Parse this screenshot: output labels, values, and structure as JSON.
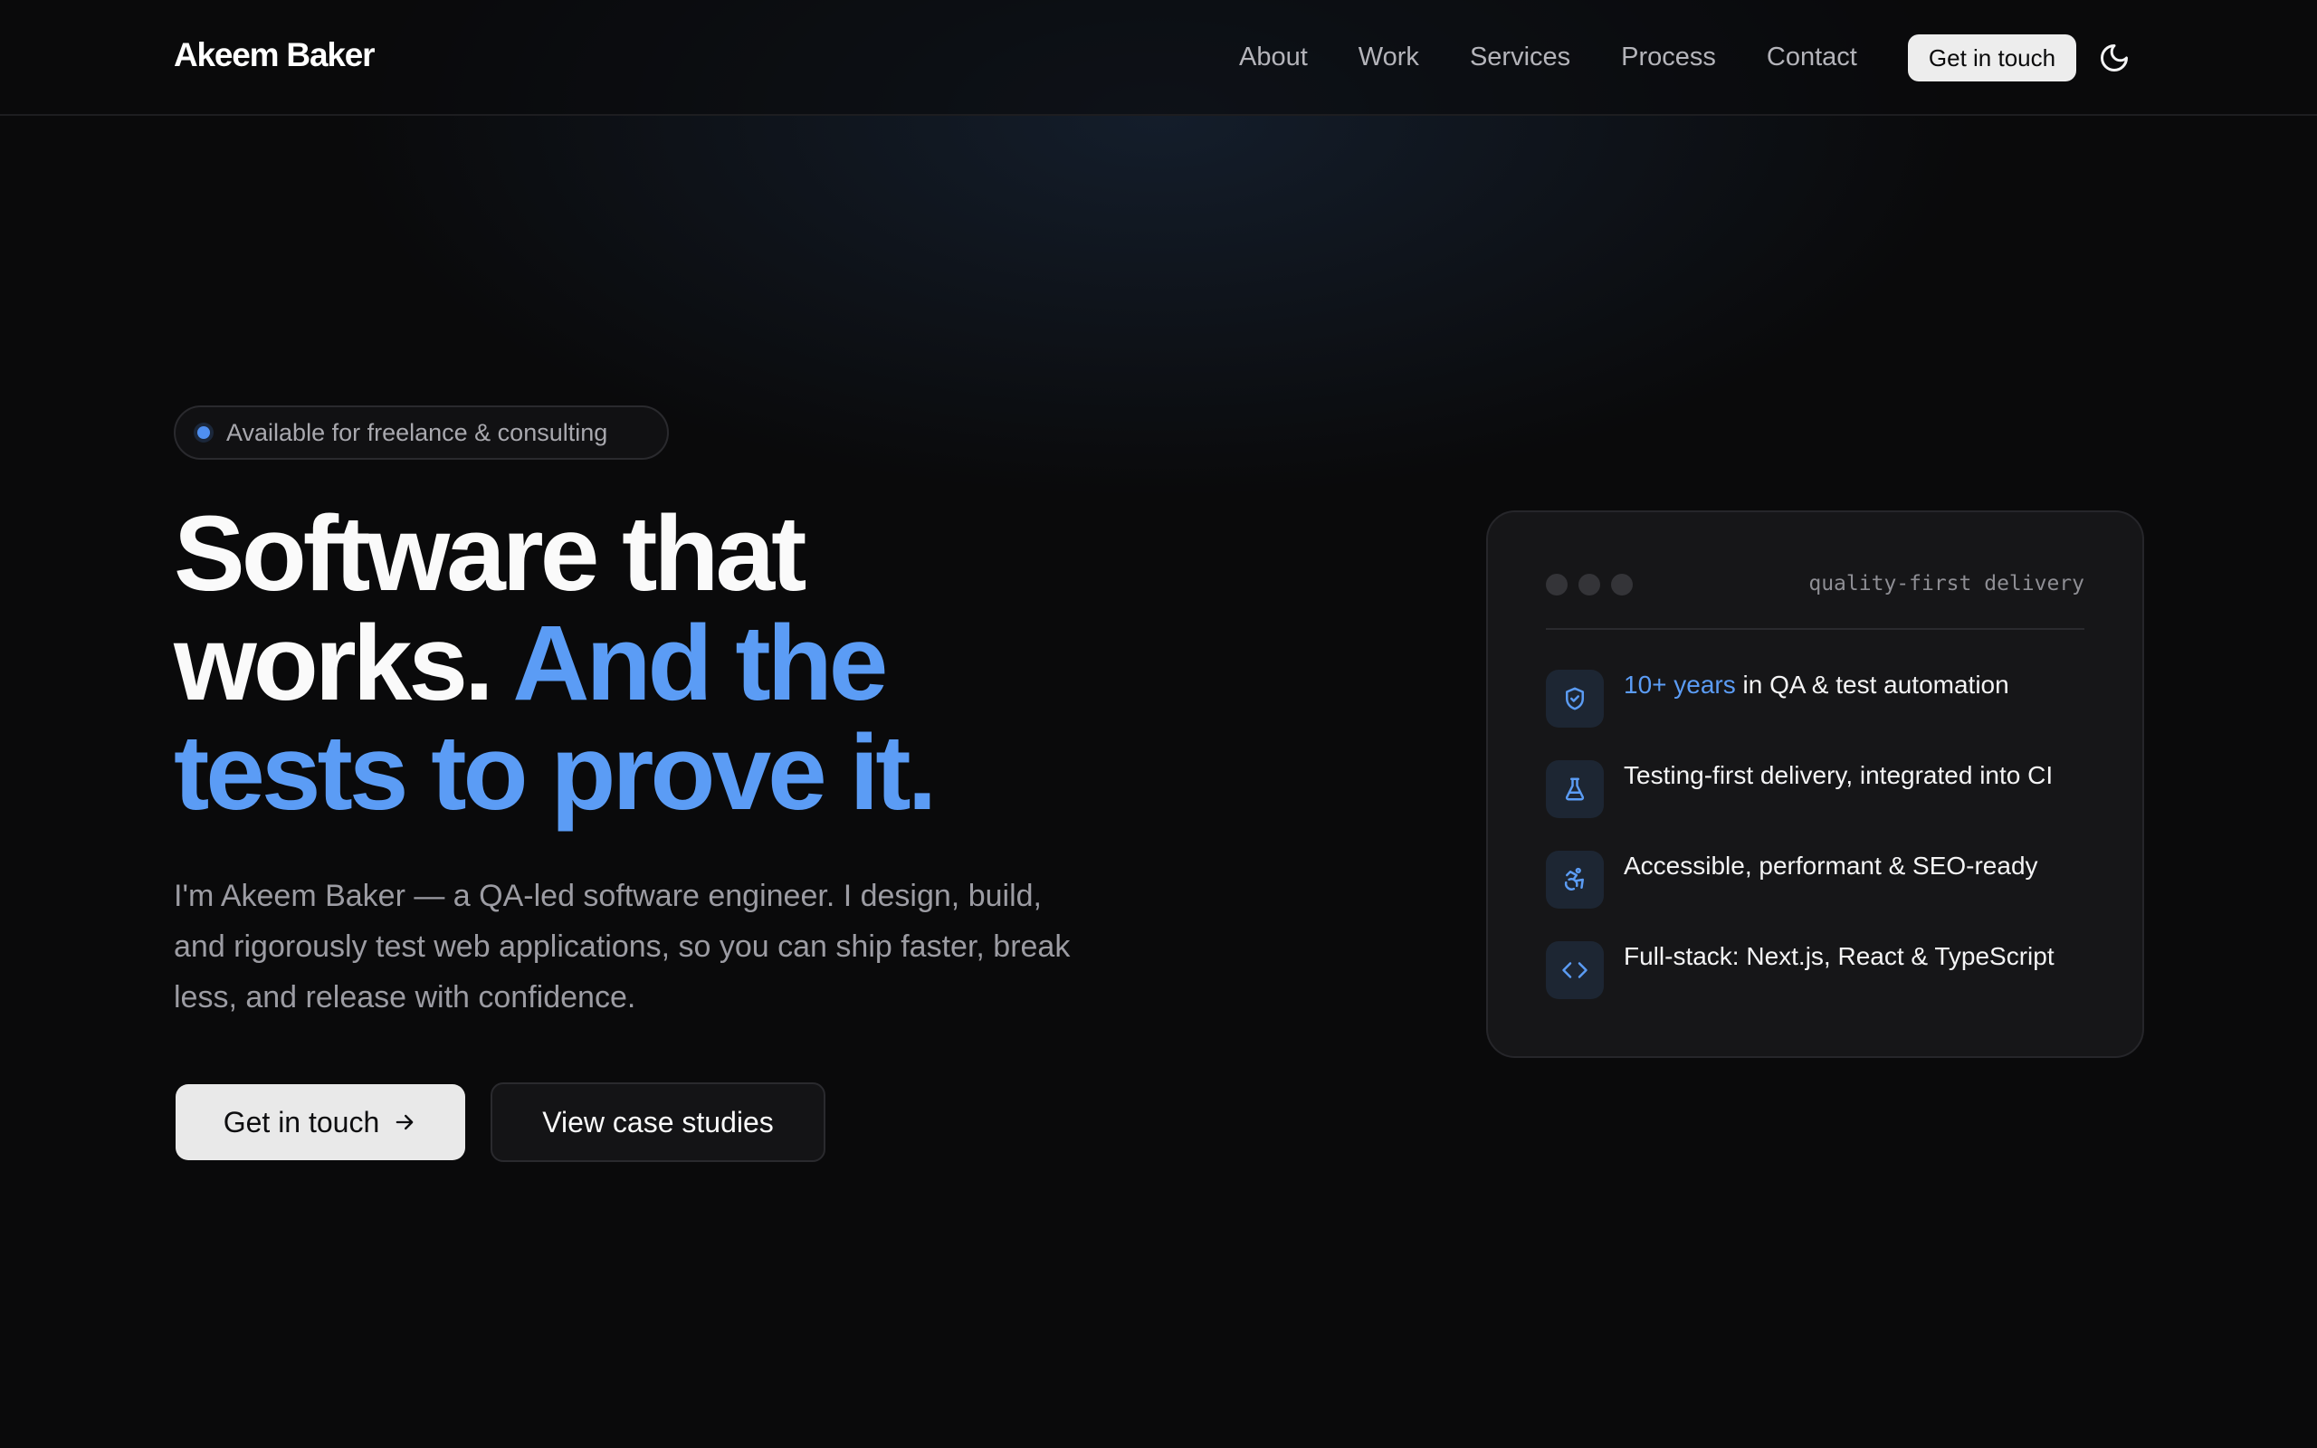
{
  "brand": "Akeem Baker",
  "nav": {
    "links": [
      "About",
      "Work",
      "Services",
      "Process",
      "Contact"
    ],
    "cta": "Get in touch",
    "theme_icon": "moon-icon"
  },
  "hero": {
    "badge": "Available for freelance & consulting",
    "headline_line1": "Software that",
    "headline_line2_plain": "works.",
    "headline_line2_accent": "And the",
    "headline_line3_accent": "tests to prove it.",
    "lead": "I'm Akeem Baker — a QA-led software engineer. I design, build, and rigorously test web applications, so you can ship faster, break less, and release with confidence.",
    "primary_cta": "Get in touch",
    "secondary_cta": "View case studies"
  },
  "card": {
    "tag": "quality-first delivery",
    "features": [
      {
        "icon": "shield-check-icon",
        "highlight": "10+ years",
        "text": " in QA & test automation"
      },
      {
        "icon": "flask-icon",
        "highlight": "",
        "text": "Testing-first delivery, integrated into CI"
      },
      {
        "icon": "accessibility-icon",
        "highlight": "",
        "text": "Accessible, performant & SEO-ready"
      },
      {
        "icon": "code-icon",
        "highlight": "",
        "text": "Full-stack: Next.js, React & TypeScript"
      }
    ]
  },
  "colors": {
    "background": "#0a0a0b",
    "accent": "#5b9cf5",
    "card": "#161618"
  }
}
